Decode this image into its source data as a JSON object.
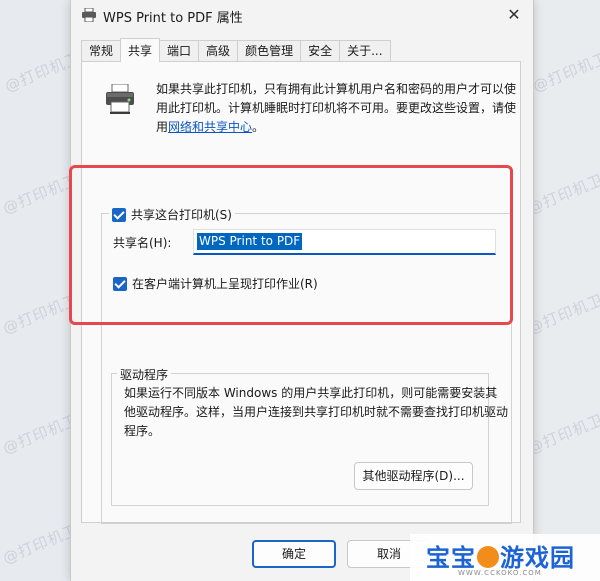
{
  "window": {
    "title": "WPS Print to PDF 属性",
    "close_glyph": "✕"
  },
  "tabs": [
    {
      "label": "常规",
      "active": false
    },
    {
      "label": "共享",
      "active": true
    },
    {
      "label": "端口",
      "active": false
    },
    {
      "label": "高级",
      "active": false
    },
    {
      "label": "颜色管理",
      "active": false
    },
    {
      "label": "安全",
      "active": false
    },
    {
      "label": "关于...",
      "active": false
    }
  ],
  "info": {
    "text": "如果共享此打印机，只有拥有此计算机用户名和密码的用户才可以使用此打印机。计算机睡眠时打印机将不可用。要更改这些设置，请使用",
    "link": "网络和共享中心",
    "tail": "。"
  },
  "share": {
    "share_checkbox_label": "共享这台打印机(S)",
    "share_checked": true,
    "share_name_label": "共享名(H):",
    "share_name_value": "WPS Print to PDF",
    "render_checkbox_label": "在客户端计算机上呈现打印作业(R)",
    "render_checked": true
  },
  "drivers": {
    "legend": "驱动程序",
    "text": "如果运行不同版本 Windows 的用户共享此打印机，则可能需要安装其他驱动程序。这样，当用户连接到共享打印机时就不需要查找打印机驱动程序。",
    "button": "其他驱动程序(D)..."
  },
  "footer": {
    "ok": "确定",
    "cancel": "取消"
  },
  "watermark": {
    "text": "@打印机卫士"
  },
  "brand": {
    "name_part1": "宝宝",
    "name_part2": "游戏园",
    "url": "WWW.CCKOKO.COM"
  },
  "colors": {
    "accent": "#1a66c8",
    "highlight": "#e5484d",
    "link": "#0a57c2"
  },
  "icons": {
    "printer": "printer-icon",
    "close": "close-icon",
    "checkbox": "checkbox-checked-icon"
  }
}
